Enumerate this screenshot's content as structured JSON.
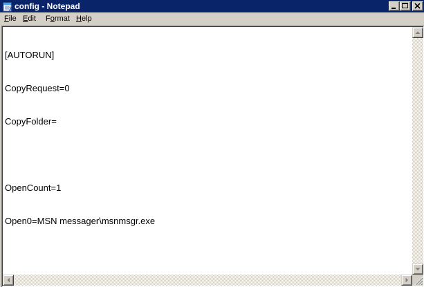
{
  "window": {
    "title": "config - Notepad",
    "app_icon": "notepad-icon",
    "caption_buttons": [
      "minimize-icon",
      "maximize-icon",
      "close-icon"
    ]
  },
  "menubar": {
    "items": [
      {
        "accel": "F",
        "rest": "ile"
      },
      {
        "accel": "E",
        "rest": "dit"
      },
      {
        "pre": "F",
        "accel": "o",
        "rest": "rmat"
      },
      {
        "accel": "H",
        "rest": "elp"
      }
    ]
  },
  "editor": {
    "lines": [
      "[AUTORUN]",
      "CopyRequest=0",
      "CopyFolder=",
      "",
      "OpenCount=1",
      "Open0=MSN messager\\msnmsgr.exe"
    ]
  },
  "colors": {
    "titlebar": "#0a246a",
    "face": "#d4d0c8",
    "text": "#000000"
  }
}
